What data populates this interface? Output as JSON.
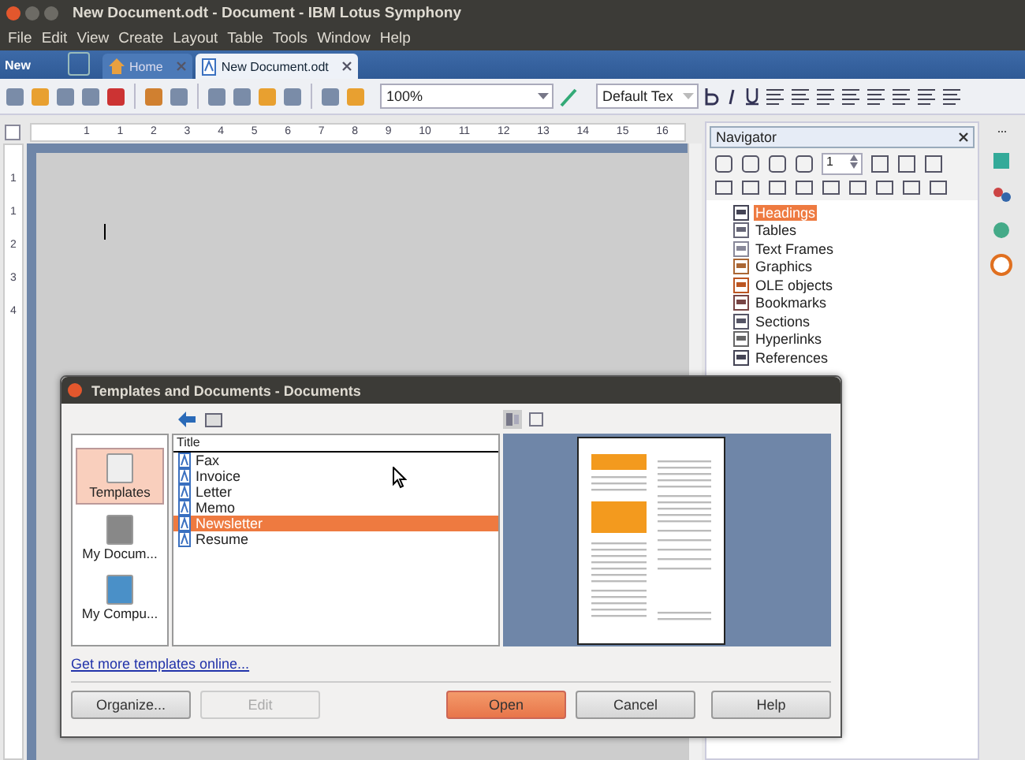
{
  "window": {
    "title": "New Document.odt - Document - IBM Lotus Symphony"
  },
  "menu": [
    "File",
    "Edit",
    "View",
    "Create",
    "Layout",
    "Table",
    "Tools",
    "Window",
    "Help"
  ],
  "tab_bar": {
    "new_label": "New",
    "tabs": [
      {
        "label": "Home",
        "selected": false,
        "kind": "home"
      },
      {
        "label": "New Document.odt",
        "selected": true,
        "kind": "document"
      }
    ]
  },
  "toolbar": {
    "zoom": "100%",
    "style": "Default Tex"
  },
  "ruler": {
    "marks": [
      "1",
      "1",
      "2",
      "3",
      "4",
      "5",
      "6",
      "7",
      "8",
      "9",
      "10",
      "11",
      "12",
      "13",
      "14",
      "15",
      "16"
    ]
  },
  "vertical_ruler": {
    "marks": [
      "1",
      "1",
      "2",
      "3",
      "4"
    ]
  },
  "navigator": {
    "title": "Navigator",
    "page": "1",
    "items": [
      {
        "label": "Headings",
        "selected": true,
        "kind": "headings"
      },
      {
        "label": "Tables",
        "selected": false,
        "kind": "tables"
      },
      {
        "label": "Text Frames",
        "selected": false,
        "kind": "frames"
      },
      {
        "label": "Graphics",
        "selected": false,
        "kind": "graphics"
      },
      {
        "label": "OLE objects",
        "selected": false,
        "kind": "ole"
      },
      {
        "label": "Bookmarks",
        "selected": false,
        "kind": "bookmarks"
      },
      {
        "label": "Sections",
        "selected": false,
        "kind": "sections"
      },
      {
        "label": "Hyperlinks",
        "selected": false,
        "kind": "hyperlinks"
      },
      {
        "label": "References",
        "selected": false,
        "kind": "references"
      }
    ]
  },
  "dialog": {
    "title": "Templates and Documents - Documents",
    "places": [
      {
        "label": "Templates",
        "selected": true,
        "kind": "templates"
      },
      {
        "label": "My Docum...",
        "selected": false,
        "kind": "documents"
      },
      {
        "label": "My Compu...",
        "selected": false,
        "kind": "computer"
      }
    ],
    "column": "Title",
    "files": [
      {
        "label": "Fax",
        "selected": false
      },
      {
        "label": "Invoice",
        "selected": false
      },
      {
        "label": "Letter",
        "selected": false
      },
      {
        "label": "Memo",
        "selected": false
      },
      {
        "label": "Newsletter",
        "selected": true
      },
      {
        "label": "Resume",
        "selected": false
      }
    ],
    "link": "Get more templates online...",
    "buttons": [
      {
        "label": "Organize...",
        "kind": "default",
        "disabled": false
      },
      {
        "label": "Edit",
        "kind": "default",
        "disabled": true
      },
      {
        "label": "Open",
        "kind": "primary",
        "disabled": false
      },
      {
        "label": "Cancel",
        "kind": "default",
        "disabled": false
      },
      {
        "label": "Help",
        "kind": "default",
        "disabled": false
      }
    ]
  }
}
